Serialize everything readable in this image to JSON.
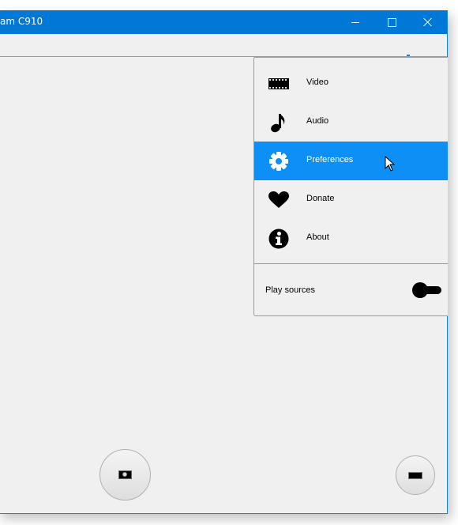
{
  "window": {
    "title": "am C910",
    "caption_buttons": {
      "minimize": "minimize-icon",
      "maximize": "maximize-icon",
      "close": "close-icon"
    },
    "accent_color": "#0078d7"
  },
  "menu": {
    "items": [
      {
        "label": "Video",
        "icon": "film-strip-icon",
        "selected": false
      },
      {
        "label": "Audio",
        "icon": "music-note-icon",
        "selected": false
      },
      {
        "label": "Preferences",
        "icon": "gear-icon",
        "selected": true
      },
      {
        "label": "Donate",
        "icon": "heart-icon",
        "selected": false
      },
      {
        "label": "About",
        "icon": "info-icon",
        "selected": false
      }
    ],
    "selected_color": "#0d8ff5",
    "toggle": {
      "label": "Play sources",
      "state": "off"
    }
  },
  "controls": {
    "snapshot": "camera-icon",
    "fullscreen": "fullscreen-icon"
  }
}
